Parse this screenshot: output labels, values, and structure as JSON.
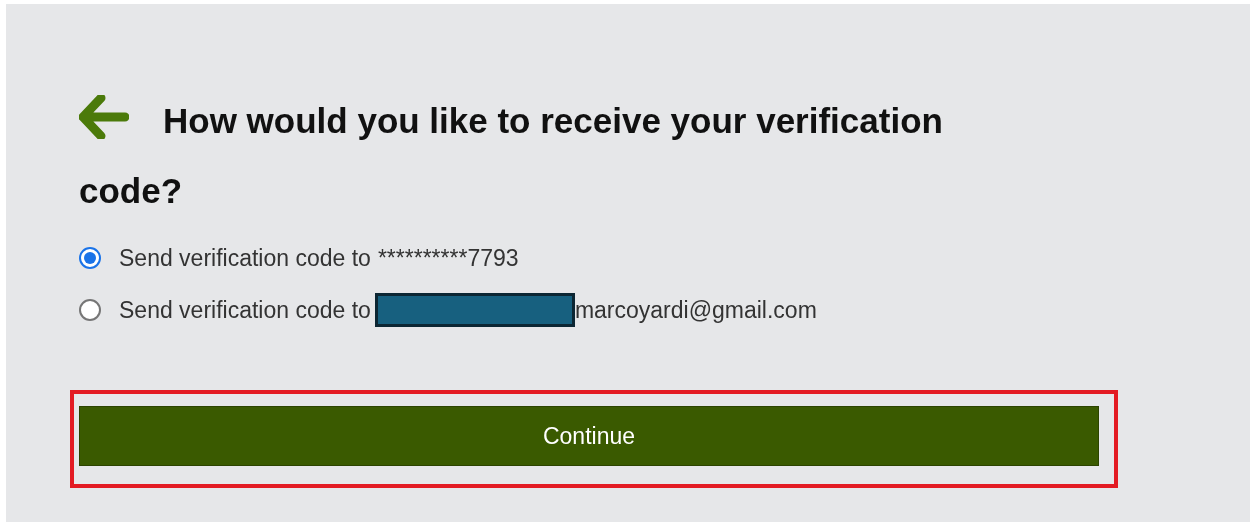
{
  "heading": {
    "back_icon": true,
    "text": "How would you like to receive your verification code?"
  },
  "options": [
    {
      "label": "Send verification code to",
      "value": "**********7793",
      "selected": true,
      "redacted": false
    },
    {
      "label": "Send verification code to",
      "value": "marcoyardi@gmail.com",
      "selected": false,
      "redacted": true
    }
  ],
  "continue_button": {
    "label": "Continue",
    "highlighted": true
  }
}
